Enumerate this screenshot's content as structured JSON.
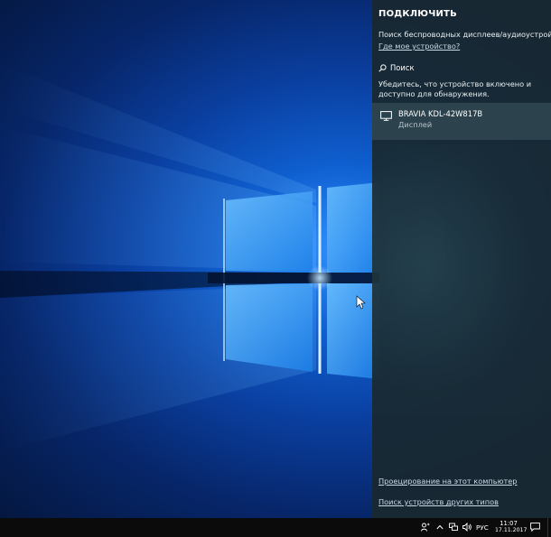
{
  "panel": {
    "title": "ПОДКЛЮЧИТЬ",
    "subtitle": "Поиск беспроводных дисплеев/аудиоустройств",
    "where_link": "Где мое устройство?",
    "search_label": "Поиск",
    "hint": "Убедитесь, что устройство включено и доступно для обнаружения.",
    "devices": [
      {
        "name": "BRAVIA KDL-42W817B",
        "type": "Дисплей",
        "icon": "monitor-icon"
      }
    ],
    "projecting_link": "Проецирование на этот компьютер",
    "other_devices_link": "Поиск устройств других типов"
  },
  "taskbar": {
    "language": "РУС",
    "time": "11:07",
    "date": "17.11.2017",
    "tray_icons": [
      "people-icon",
      "chevron-up-icon",
      "network-icon",
      "volume-icon",
      "action-center-icon"
    ]
  },
  "colors": {
    "panel_bg": "#182830",
    "device_highlight": "#304852",
    "link": "#c9d8e6",
    "taskbar_bg": "#0b0b0b",
    "wallpaper_accent": "#2f8fff"
  }
}
